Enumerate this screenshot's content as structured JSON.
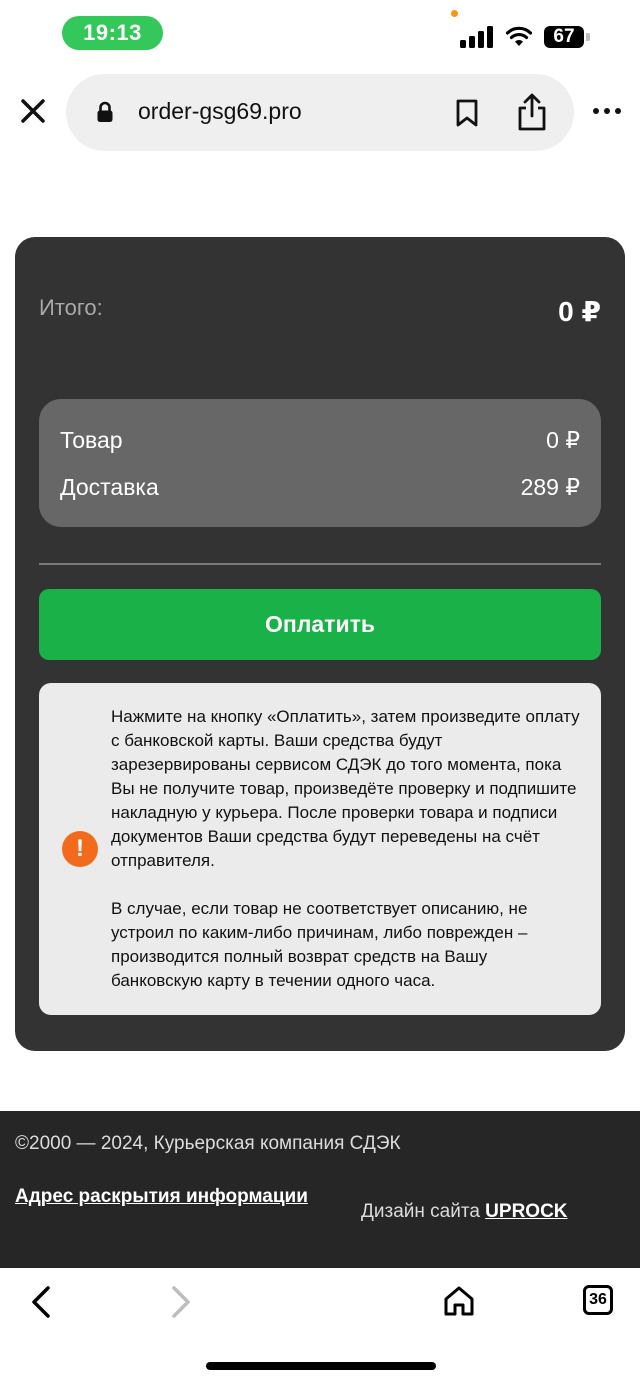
{
  "status_bar": {
    "time": "19:13",
    "battery": "67",
    "icons": [
      "signal-icon",
      "wifi-icon",
      "battery-icon"
    ]
  },
  "browser": {
    "url": "order-gsg69.pro",
    "icons": [
      "close-icon",
      "lock-icon",
      "bookmark-icon",
      "share-icon",
      "more-icon"
    ]
  },
  "checkout": {
    "total_label": "Итого:",
    "total_value": "0 ₽",
    "items": [
      {
        "label": "Товар",
        "value": "0 ₽"
      },
      {
        "label": "Доставка",
        "value": "289 ₽"
      }
    ],
    "pay_button_label": "Оплатить",
    "info_paragraph_1": "Нажмите на кнопку «Оплатить», затем произведите оплату с банковской карты. Ваши средства будут зарезервированы сервисом СДЭК до того момента, пока Вы не получите товар, произведёте проверку и подпишите накладную у курьера. После проверки товара и подписи документов Ваши средства будут переведены на счёт отправителя.",
    "info_paragraph_2": "В случае, если товар не соответствует описанию, не устроил по каким-либо причинам, либо поврежден – производится полный возврат средств на Вашу банковскую карту в течении одного часа.",
    "alert_glyph": "!"
  },
  "footer": {
    "copyright": "©2000 — 2024, Курьерская компания СДЭК",
    "disclosure_link": "Адрес раскрытия информации",
    "design_prefix": "Дизайн сайта",
    "design_link": "UPROCK"
  },
  "bottom_nav": {
    "tab_count": "36",
    "icons": [
      "back-icon",
      "forward-icon",
      "home-icon",
      "tabs-icon"
    ]
  },
  "colors": {
    "time_pill": "#34c759",
    "card": "#333333",
    "summary_box": "#676767",
    "pay_button": "#1ab248",
    "info_box": "#ebebeb",
    "alert": "#f26b1d",
    "footer": "#262626"
  }
}
